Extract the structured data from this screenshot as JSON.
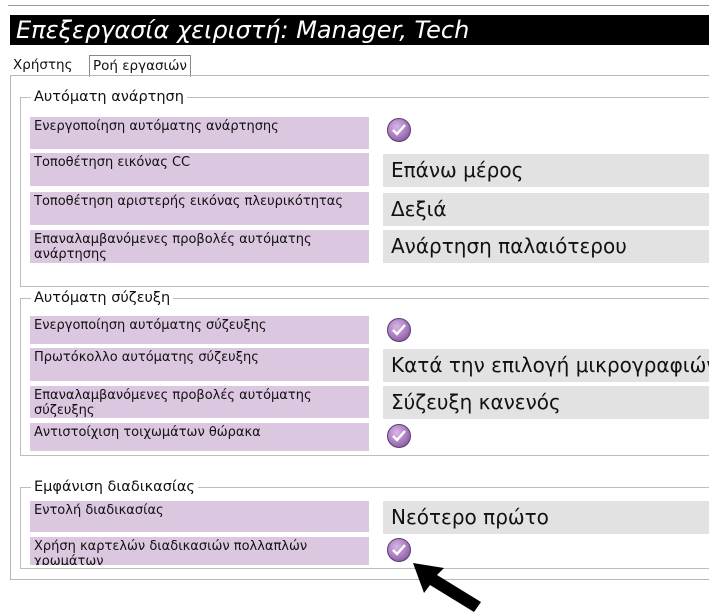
{
  "window": {
    "title": "Επεξεργασία χειριστή: Manager, Tech"
  },
  "tabs": [
    {
      "label": "Χρήστης"
    },
    {
      "label": "Ροή εργασιών",
      "selected": true
    }
  ],
  "groups": [
    {
      "title": "Αυτόματη ανάρτηση",
      "rows": [
        {
          "label": "Ενεργοποίηση αυτόματης ανάρτησης",
          "checked": true
        },
        {
          "label": "Τοποθέτηση εικόνας CC",
          "value": "Επάνω μέρος"
        },
        {
          "label": "Τοποθέτηση αριστερής εικόνας πλευρικότητας",
          "value": "Δεξιά"
        },
        {
          "label": "Επαναλαμβανόμενες προβολές αυτόματης ανάρτησης",
          "value": "Ανάρτηση παλαιότερου"
        }
      ]
    },
    {
      "title": "Αυτόματη σύζευξη",
      "rows": [
        {
          "label": "Ενεργοποίηση αυτόματης σύζευξης",
          "checked": true
        },
        {
          "label": "Πρωτόκολλο αυτόματης σύζευξης",
          "value": "Κατά την επιλογή μικρογραφιών"
        },
        {
          "label": "Επαναλαμβανόμενες προβολές αυτόματης σύζευξης",
          "value": "Σύζευξη κανενός"
        },
        {
          "label": "Αντιστοίχιση τοιχωμάτων θώρακα",
          "checked": true
        }
      ]
    },
    {
      "title": "Εμφάνιση διαδικασίας",
      "rows": [
        {
          "label": "Εντολή διαδικασίας",
          "value": "Νεότερο πρώτο"
        },
        {
          "label": "Χρήση καρτελών διαδικασιών πολλαπλών χρωμάτων",
          "checked": true
        }
      ]
    }
  ],
  "colors": {
    "label_bg": "#dcc7e1",
    "field_bg": "#e2e2e2",
    "check": "#a678bd",
    "title_bg": "#000000"
  },
  "icons": {
    "checkbox": "check-circle-icon",
    "pointer": "arrow-pointer-icon"
  }
}
